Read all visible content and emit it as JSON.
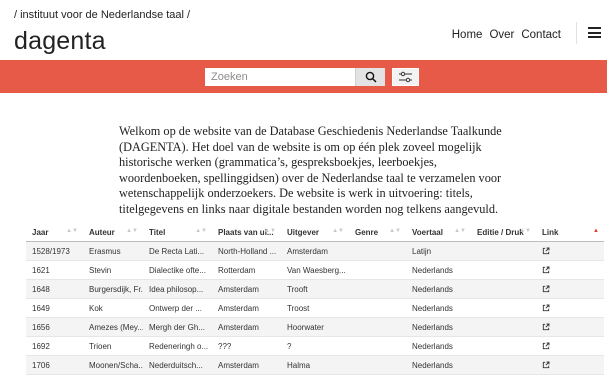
{
  "header": {
    "institute": "/ instituut voor de Nederlandse taal /",
    "brand": "dagenta",
    "nav": [
      "Home",
      "Over",
      "Contact"
    ]
  },
  "search": {
    "placeholder": "Zoeken"
  },
  "intro": "Welkom op de website van de Database Geschiedenis Nederlandse Taalkunde (DAGENTA). Het doel van de website is om op één plek zoveel mogelijk historische werken (grammatica’s, gespreksboekjes, leerboekjes, woordenboeken, spellinggidsen) over de Nederlandse taal te verzamelen voor wetenschappelijk onderzoekers. De website is werk in uitvoering: titels, titelgegevens en links naar digitale bestanden worden nog telkens aangevuld.",
  "table": {
    "columns": [
      "Jaar",
      "Auteur",
      "Titel",
      "Plaats van ui...",
      "Uitgever",
      "Genre",
      "Voertaal",
      "Editie / Druk",
      "Link"
    ],
    "rows": [
      [
        "1528/1973",
        "Erasmus",
        "De Recta Lati...",
        "North-Holland ...",
        "Amsterdam",
        "",
        "Latijn",
        "",
        ""
      ],
      [
        "1621",
        "Stevin",
        "Dialectike ofte...",
        "Rotterdam",
        "Van Waesberg...",
        "",
        "Nederlands",
        "",
        ""
      ],
      [
        "1648",
        "Burgersdijk, Fr...",
        "Idea philosop...",
        "Amsterdam",
        "Trooft",
        "",
        "Nederlands",
        "",
        ""
      ],
      [
        "1649",
        "Kok",
        "Ontwerp der ...",
        "Amsterdam",
        "Troost",
        "",
        "Nederlands",
        "",
        ""
      ],
      [
        "1656",
        "Amezes (Mey...",
        "Mergh der Gh...",
        "Amsterdam",
        "Hoorwater",
        "",
        "Nederlands",
        "",
        ""
      ],
      [
        "1692",
        "Trioen",
        "Redeneringh o...",
        "???",
        "?",
        "",
        "Nederlands",
        "",
        ""
      ],
      [
        "1706",
        "Moonen/Scha...",
        "Nederduitsch...",
        "Amsterdam",
        "Halma",
        "",
        "Nederlands",
        "",
        ""
      ]
    ]
  },
  "icons": {
    "search": "search-icon",
    "filter": "sliders-icon",
    "menu": "hamburger-menu-icon",
    "link": "external-link-icon",
    "sort": "sort-icon"
  },
  "colors": {
    "accent": "#e85a48",
    "sort_active": "#e03b2d"
  }
}
